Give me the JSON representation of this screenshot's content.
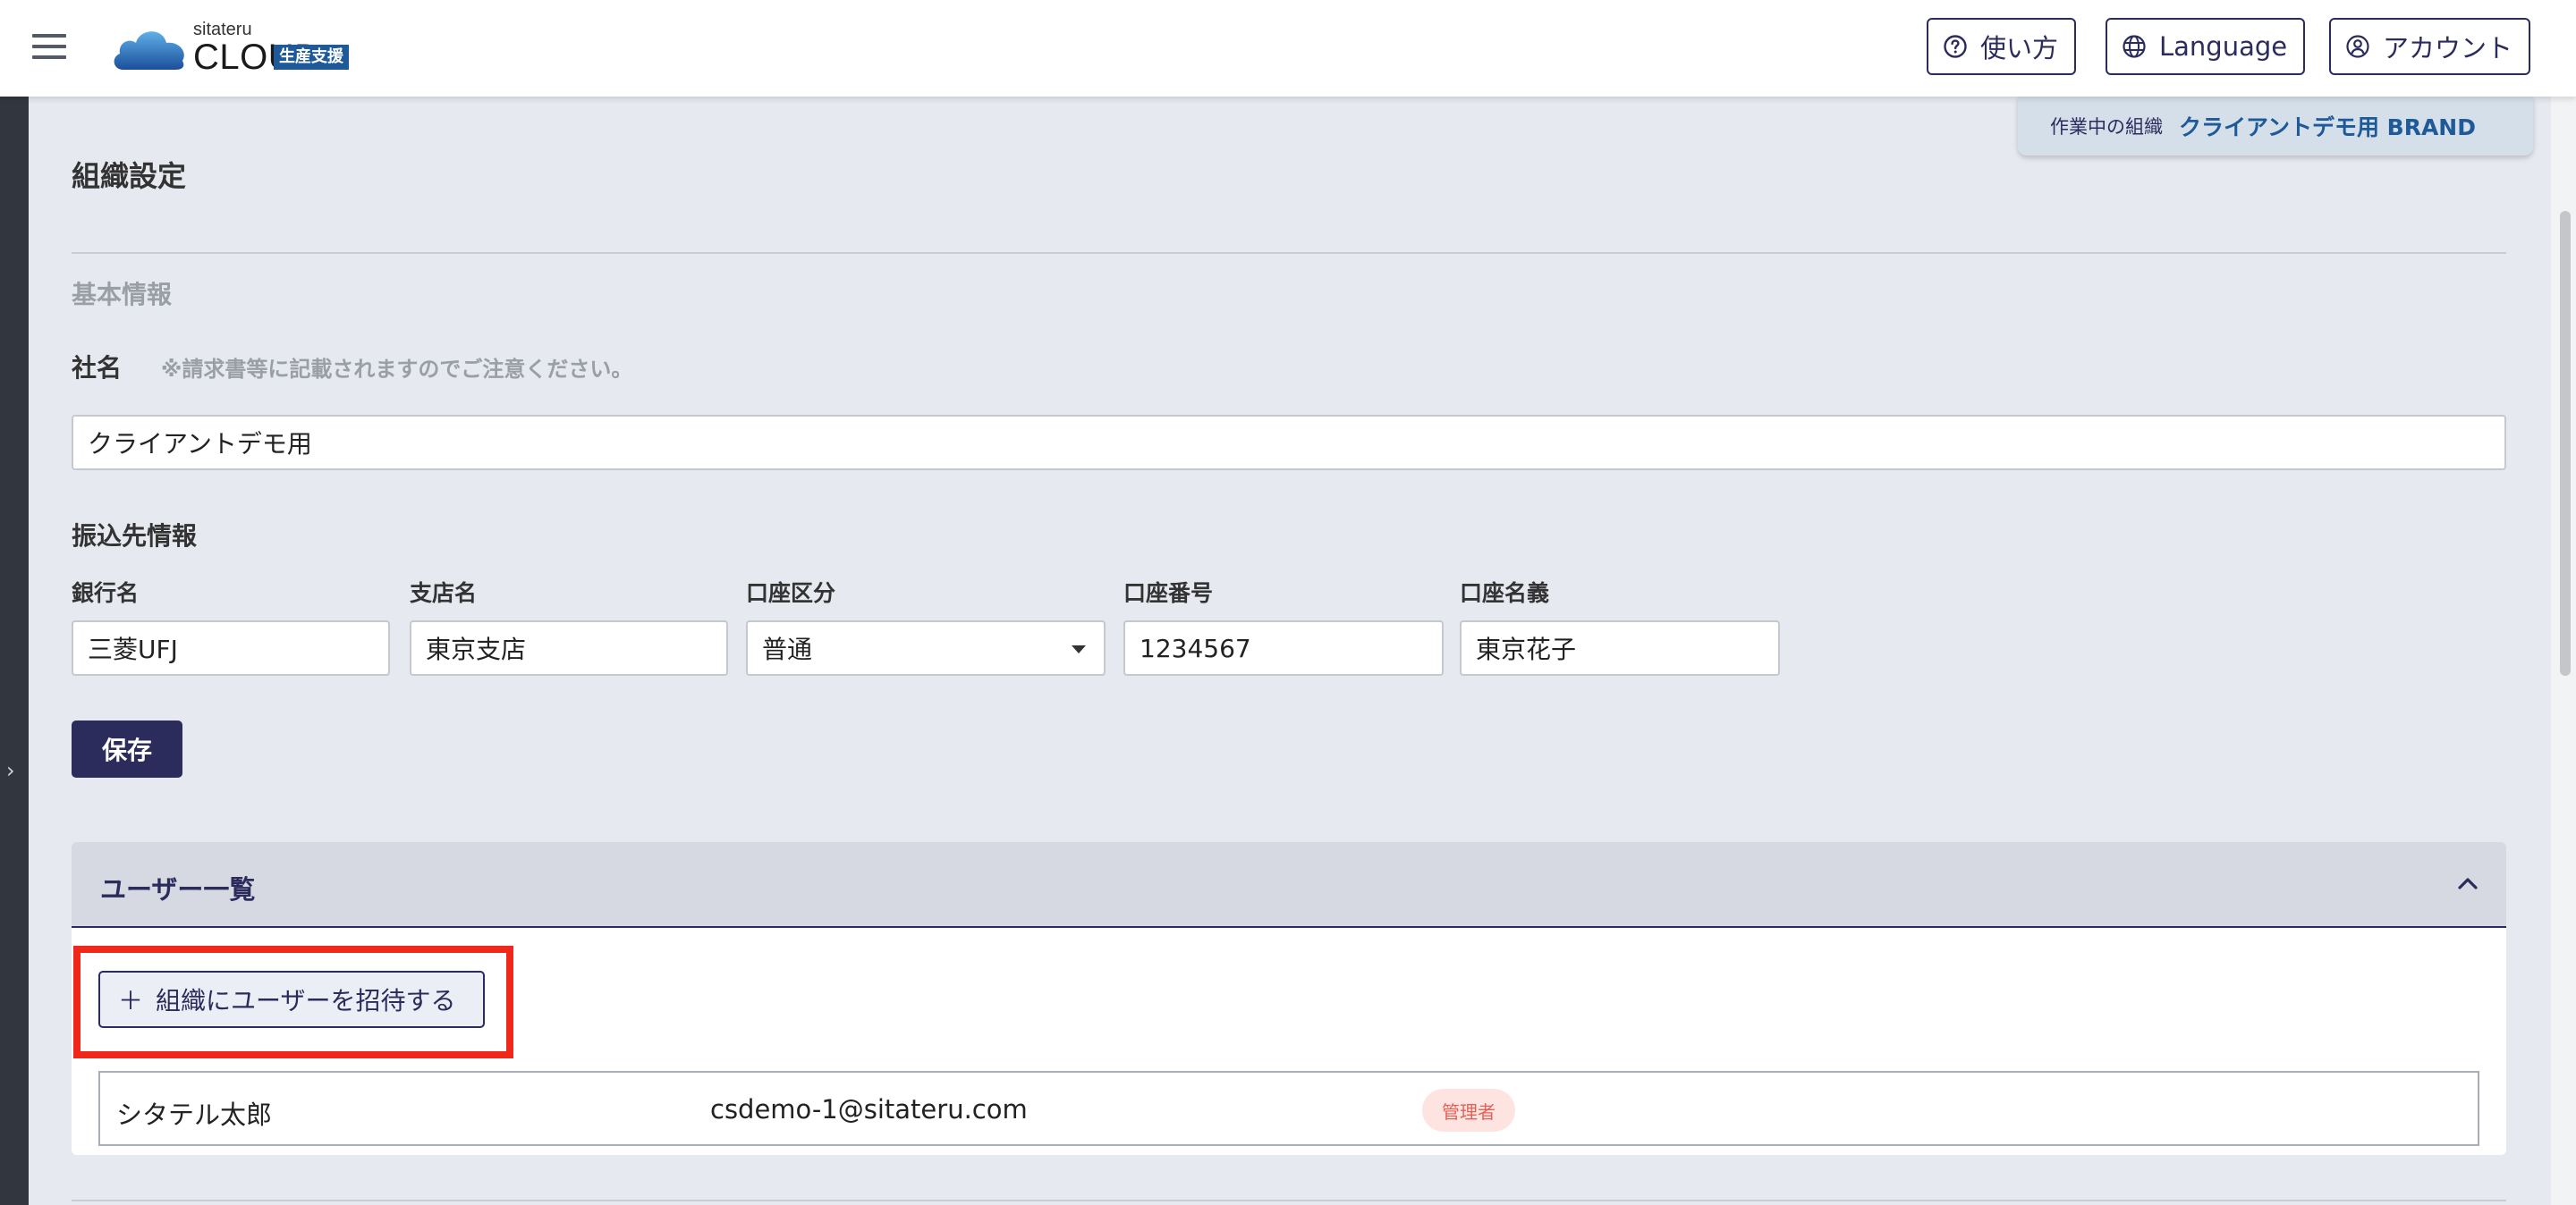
{
  "header": {
    "logo_small": "sitateru",
    "logo_big": "CLOUD",
    "logo_badge": "生産支援",
    "buttons": {
      "help": "使い方",
      "language": "Language",
      "account": "アカウント"
    }
  },
  "org_tab": {
    "label": "作業中の組織",
    "name": "クライアントデモ用 BRAND"
  },
  "page": {
    "title": "組織設定",
    "section_basic": "基本情報",
    "company": {
      "label": "社名",
      "note": "※請求書等に記載されますのでご注意ください。",
      "value": "クライアントデモ用"
    },
    "bank": {
      "section_label": "振込先情報",
      "fields": {
        "bank_name": {
          "label": "銀行名",
          "value": "三菱UFJ"
        },
        "branch": {
          "label": "支店名",
          "value": "東京支店"
        },
        "account_type": {
          "label": "口座区分",
          "value": "普通"
        },
        "account_number": {
          "label": "口座番号",
          "value": "1234567"
        },
        "account_holder": {
          "label": "口座名義",
          "value": "東京花子"
        }
      }
    },
    "save_label": "保存"
  },
  "users_panel": {
    "title": "ユーザー一覧",
    "invite_label": "組織にユーザーを招待する",
    "invite_plus": "＋",
    "users": [
      {
        "name": "シタテル太郎",
        "email": "csdemo-1@sitateru.com",
        "role": "管理者"
      }
    ]
  },
  "colors": {
    "primary": "#2b2c5c",
    "accent": "#1e5a99",
    "highlight": "#f0281a",
    "role_badge_bg": "#fde4e1",
    "role_badge_text": "#e66056"
  }
}
